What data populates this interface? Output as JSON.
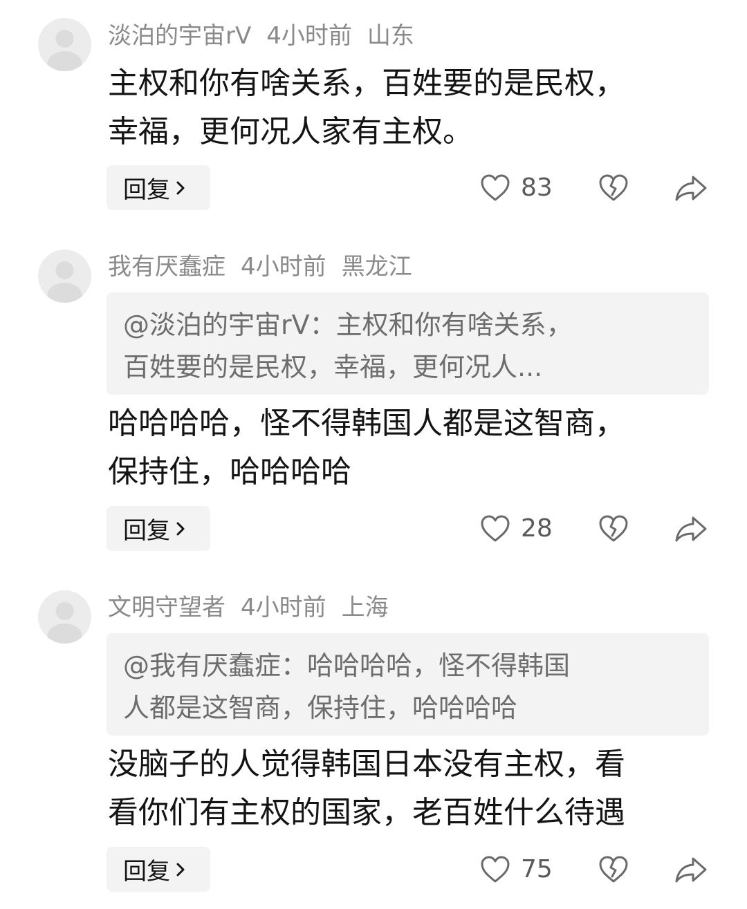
{
  "comments": [
    {
      "username": "淡泊的宇宙rV",
      "time": "4小时前",
      "location": "山东",
      "quote": "",
      "text_lines": [
        "主权和你有啥关系，百姓要的是民权，",
        "幸福，更何况人家有主权。"
      ],
      "reply_label": "回复",
      "likes": "83"
    },
    {
      "username": "我有厌蠢症",
      "time": "4小时前",
      "location": "黑龙江",
      "quote_lines": [
        "@淡泊的宇宙rV：主权和你有啥关系，",
        "百姓要的是民权，幸福，更何况人..."
      ],
      "text_lines": [
        "哈哈哈哈，怪不得韩国人都是这智商，",
        "保持住，哈哈哈哈"
      ],
      "reply_label": "回复",
      "likes": "28"
    },
    {
      "username": "文明守望者",
      "time": "4小时前",
      "location": "上海",
      "quote_lines": [
        "@我有厌蠢症：哈哈哈哈，怪不得韩国",
        "人都是这智商，保持住，哈哈哈哈"
      ],
      "text_lines": [
        "没脑子的人觉得韩国日本没有主权，看",
        "看你们有主权的国家，老百姓什么待遇"
      ],
      "reply_label": "回复",
      "likes": "75"
    }
  ],
  "icons": {
    "avatar": "default-avatar-icon",
    "reply_arrow": "chevron-right-icon",
    "like": "heart-outline-icon",
    "dislike": "broken-heart-icon",
    "share": "share-arrow-icon"
  },
  "colors": {
    "meta_text": "#8a8a8a",
    "body_text": "#141414",
    "quote_bg": "#f3f3f3",
    "quote_text": "#6d6d6d",
    "icon": "#6a6a6a"
  }
}
